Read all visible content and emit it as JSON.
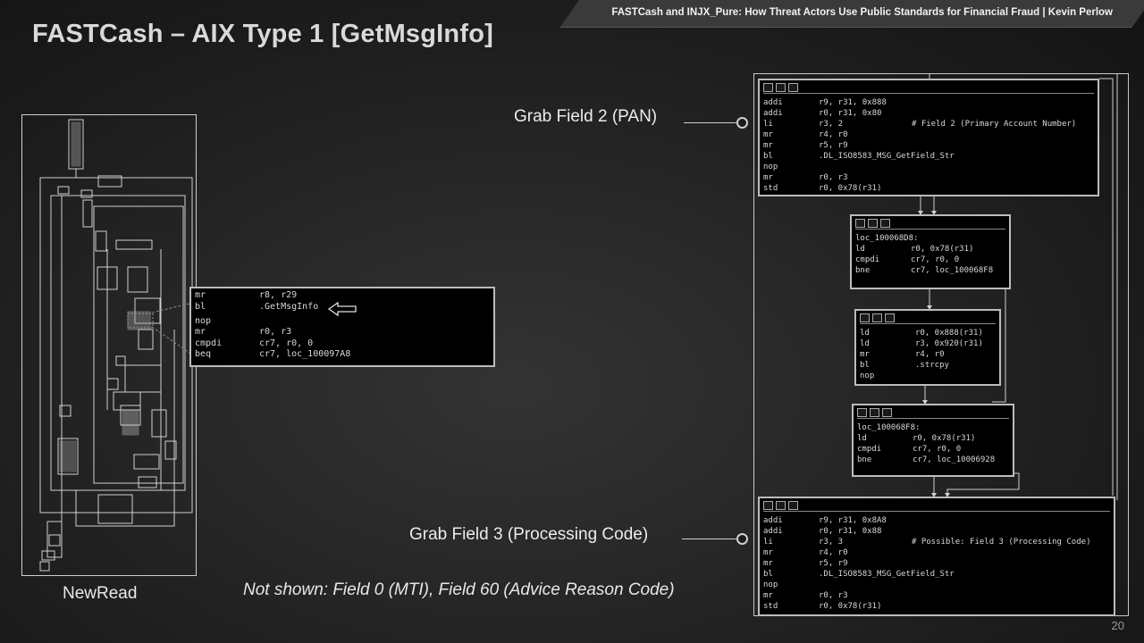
{
  "header": {
    "text": "FASTCash and INJX_Pure: How Threat Actors Use Public Standards for Financial Fraud | Kevin Perlow"
  },
  "title": "FASTCash – AIX Type 1 [GetMsgInfo]",
  "thumbnail": {
    "label": "NewRead"
  },
  "popup": {
    "lines": [
      {
        "op": "mr",
        "args": "r8, r29"
      },
      {
        "op": "bl",
        "args": ".GetMsgInfo"
      },
      {
        "op": "nop",
        "args": ""
      },
      {
        "op": "mr",
        "args": "r0, r3"
      },
      {
        "op": "cmpdi",
        "args": "cr7, r0, 0"
      },
      {
        "op": "beq",
        "args": "cr7, loc_100097A8"
      }
    ]
  },
  "blocks": {
    "b1": {
      "lines": [
        {
          "op": "addi",
          "args": "r9, r31, 0x888",
          "cmt": ""
        },
        {
          "op": "addi",
          "args": "r0, r31, 0x80",
          "cmt": ""
        },
        {
          "op": "li",
          "args": "r3, 2",
          "cmt": "# Field 2 (Primary Account Number)"
        },
        {
          "op": "mr",
          "args": "r4, r0",
          "cmt": ""
        },
        {
          "op": "mr",
          "args": "r5, r9",
          "cmt": ""
        },
        {
          "op": "bl",
          "args": ".DL_ISO8583_MSG_GetField_Str",
          "cmt": ""
        },
        {
          "op": "nop",
          "args": "",
          "cmt": ""
        },
        {
          "op": "mr",
          "args": "r0, r3",
          "cmt": ""
        },
        {
          "op": "std",
          "args": "r0, 0x78(r31)",
          "cmt": ""
        }
      ]
    },
    "b2": {
      "label": "loc_100068D8:",
      "lines": [
        {
          "op": "ld",
          "args": "r0, 0x78(r31)"
        },
        {
          "op": "cmpdi",
          "args": "cr7, r0, 0"
        },
        {
          "op": "bne",
          "args": "cr7, loc_100068F8"
        }
      ]
    },
    "b3": {
      "lines": [
        {
          "op": "ld",
          "args": "r0, 0x888(r31)"
        },
        {
          "op": "ld",
          "args": "r3, 0x920(r31)"
        },
        {
          "op": "mr",
          "args": "r4, r0"
        },
        {
          "op": "bl",
          "args": ".strcpy"
        },
        {
          "op": "nop",
          "args": ""
        }
      ]
    },
    "b4": {
      "label": "loc_100068F8:",
      "lines": [
        {
          "op": "ld",
          "args": "r0, 0x78(r31)"
        },
        {
          "op": "cmpdi",
          "args": "cr7, r0, 0"
        },
        {
          "op": "bne",
          "args": "cr7, loc_10006928"
        }
      ]
    },
    "b5": {
      "lines": [
        {
          "op": "addi",
          "args": "r9, r31, 0x8A8",
          "cmt": ""
        },
        {
          "op": "addi",
          "args": "r0, r31, 0x88",
          "cmt": ""
        },
        {
          "op": "li",
          "args": "r3, 3",
          "cmt": "# Possible: Field 3 (Processing Code)"
        },
        {
          "op": "mr",
          "args": "r4, r0",
          "cmt": ""
        },
        {
          "op": "mr",
          "args": "r5, r9",
          "cmt": ""
        },
        {
          "op": "bl",
          "args": ".DL_ISO8583_MSG_GetField_Str",
          "cmt": ""
        },
        {
          "op": "nop",
          "args": "",
          "cmt": ""
        },
        {
          "op": "mr",
          "args": "r0, r3",
          "cmt": ""
        },
        {
          "op": "std",
          "args": "r0, 0x78(r31)",
          "cmt": ""
        }
      ]
    }
  },
  "callouts": {
    "field2": "Grab Field 2 (PAN)",
    "field3": "Grab Field 3 (Processing Code)"
  },
  "note": "Not shown: Field 0 (MTI), Field 60 (Advice Reason Code)",
  "slide_number": "20"
}
